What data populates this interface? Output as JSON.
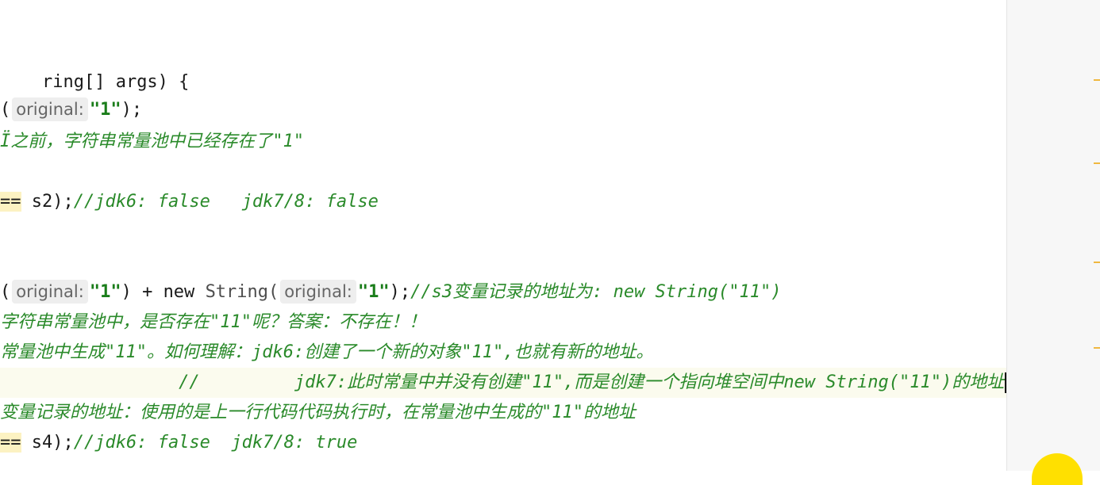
{
  "code": {
    "l1": {
      "text": "ring[] args) {"
    },
    "l2": {
      "open": "(",
      "hint": "original:",
      "str": "\"1\"",
      "close": ");"
    },
    "l3": {
      "comment": "Ϊ之前，字符串常量池中已经存在了\"1\""
    },
    "l4": {
      "op": "==",
      "code": " s2);",
      "comment": "//jdk6: false   jdk7/8: false"
    },
    "l5": {
      "open": "(",
      "hint1": "original:",
      "str1": "\"1\"",
      "mid": ") + ",
      "kw": "new",
      "cls": "String(",
      "hint2": "original:",
      "str2": "\"1\"",
      "close": ");",
      "comment": "//s3变量记录的地址为: new String(\"11\")"
    },
    "l6": {
      "comment": "字符串常量池中，是否存在\"11\"呢？答案：不存在！！"
    },
    "l7": {
      "comment": "常量池中生成\"11\"。如何理解：jdk6:创建了一个新的对象\"11\",也就有新的地址。"
    },
    "l8": {
      "comment": "                 //         jdk7:此时常量中并没有创建\"11\",而是创建一个指向堆空间中new String(\"11\")的地址"
    },
    "l9": {
      "comment": "变量记录的地址：使用的是上一行代码代码执行时，在常量池中生成的\"11\"的地址"
    },
    "l10": {
      "op": "==",
      "code": " s4);",
      "comment": "//jdk6: false  jdk7/8: true"
    }
  }
}
